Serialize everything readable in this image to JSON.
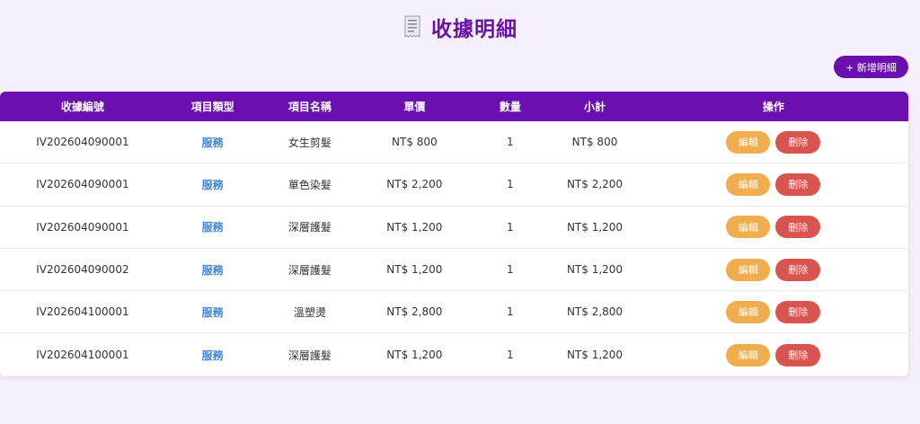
{
  "header": {
    "title": "收據明細",
    "add_button": "+ 新增明細"
  },
  "table": {
    "columns": [
      "收據編號",
      "項目類型",
      "項目名稱",
      "單價",
      "數量",
      "小計",
      "操作"
    ],
    "rows": [
      {
        "receipt_no": "IV202604090001",
        "type": "服務",
        "name": "女生剪髮",
        "price": "NT$ 800",
        "qty": "1",
        "subtotal": "NT$ 800",
        "edit": "編輯",
        "delete": "刪除"
      },
      {
        "receipt_no": "IV202604090001",
        "type": "服務",
        "name": "單色染髮",
        "price": "NT$ 2,200",
        "qty": "1",
        "subtotal": "NT$ 2,200",
        "edit": "編輯",
        "delete": "刪除"
      },
      {
        "receipt_no": "IV202604090001",
        "type": "服務",
        "name": "深層護髮",
        "price": "NT$ 1,200",
        "qty": "1",
        "subtotal": "NT$ 1,200",
        "edit": "編輯",
        "delete": "刪除"
      },
      {
        "receipt_no": "IV202604090002",
        "type": "服務",
        "name": "深層護髮",
        "price": "NT$ 1,200",
        "qty": "1",
        "subtotal": "NT$ 1,200",
        "edit": "編輯",
        "delete": "刪除"
      },
      {
        "receipt_no": "IV202604100001",
        "type": "服務",
        "name": "溫塑燙",
        "price": "NT$ 2,800",
        "qty": "1",
        "subtotal": "NT$ 2,800",
        "edit": "編輯",
        "delete": "刪除"
      },
      {
        "receipt_no": "IV202604100001",
        "type": "服務",
        "name": "深層護髮",
        "price": "NT$ 1,200",
        "qty": "1",
        "subtotal": "NT$ 1,200",
        "edit": "編輯",
        "delete": "刪除"
      }
    ]
  },
  "colors": {
    "accent": "#6b0fb0",
    "title": "#6a12a8",
    "link": "#3f86d6",
    "edit": "#f0ad4e",
    "delete": "#d9534f",
    "background": "#f6f0fd"
  },
  "icons": {
    "title_icon": "receipt-icon"
  }
}
